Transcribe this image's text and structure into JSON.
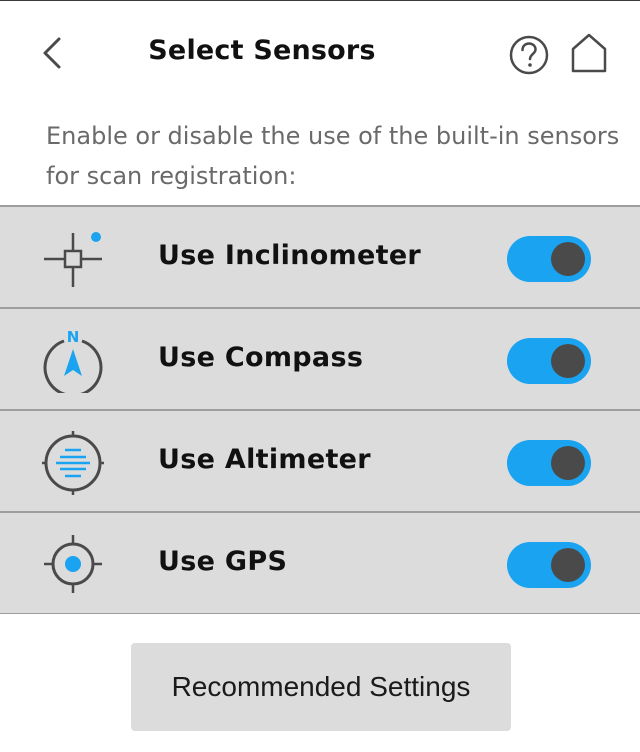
{
  "header": {
    "title": "Select Sensors",
    "back_icon": "chevron-left-icon",
    "help_icon": "help-circle-icon",
    "home_icon": "home-icon"
  },
  "description": "Enable or disable the use of the built-in sensors for scan registration:",
  "sensors": [
    {
      "label": "Use Inclinometer",
      "icon": "inclinometer-icon",
      "enabled": true
    },
    {
      "label": "Use Compass",
      "icon": "compass-icon",
      "enabled": true
    },
    {
      "label": "Use Altimeter",
      "icon": "altimeter-icon",
      "enabled": true
    },
    {
      "label": "Use GPS",
      "icon": "gps-icon",
      "enabled": true
    }
  ],
  "compass_letter": "N",
  "recommended_button": "Recommended Settings",
  "colors": {
    "accent": "#1aa3f0",
    "row_background": "#dcdcdc",
    "icon_dark": "#4a4a4a",
    "knob": "#4a4a4a"
  }
}
